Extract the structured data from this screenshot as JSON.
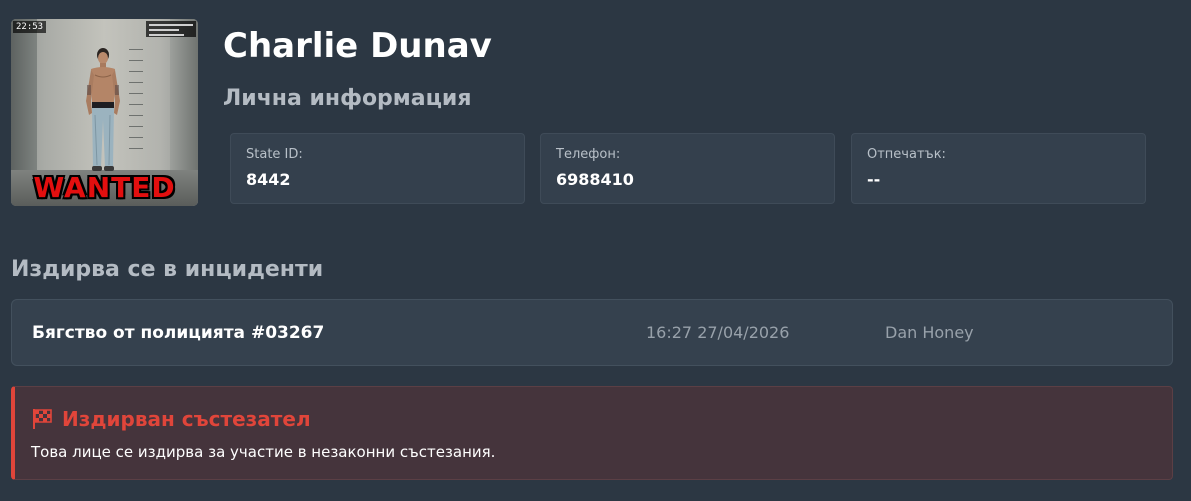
{
  "profile": {
    "name": "Charlie Dunav",
    "section_title": "Лична информация",
    "mugshot": {
      "time": "22:53",
      "stamp": "WANTED"
    }
  },
  "info": [
    {
      "label": "State ID:",
      "value": "8442"
    },
    {
      "label": "Телефон:",
      "value": "6988410"
    },
    {
      "label": "Отпечатък:",
      "value": "--"
    }
  ],
  "incidents": {
    "title": "Издирва се в инциденти",
    "items": [
      {
        "title": "Бягство от полицията #03267",
        "time": "16:27 27/04/2026",
        "officer": "Dan Honey"
      }
    ]
  },
  "alert": {
    "icon": "checkered-flag-icon",
    "title": "Издирван състезател",
    "text": "Това лице се издирва за участие в незаконни състезания.",
    "color": "#e0453a",
    "background": "#45343c"
  },
  "colors": {
    "page_background": "#2c3743",
    "card_background": "#34404d",
    "muted_heading": "#b4bbc3"
  }
}
